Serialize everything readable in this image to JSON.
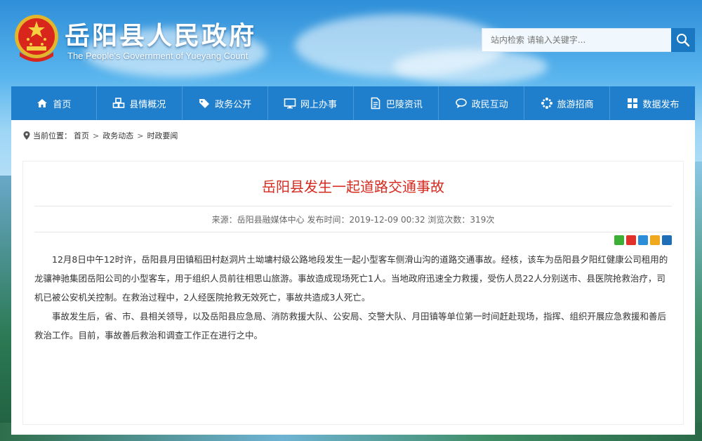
{
  "header": {
    "title": "岳阳县人民政府",
    "subtitle": "The People's Government of Yueyang Count",
    "search_placeholder": "站内检索 请输入关键字..."
  },
  "nav": {
    "items": [
      {
        "label": "首页",
        "icon": "home-icon"
      },
      {
        "label": "县情概况",
        "icon": "cubes-icon"
      },
      {
        "label": "政务公开",
        "icon": "tags-icon"
      },
      {
        "label": "网上办事",
        "icon": "monitor-icon"
      },
      {
        "label": "巴陵资讯",
        "icon": "document-icon"
      },
      {
        "label": "政民互动",
        "icon": "chat-icon"
      },
      {
        "label": "旅游招商",
        "icon": "pinwheel-icon"
      },
      {
        "label": "数据发布",
        "icon": "grid-icon"
      }
    ]
  },
  "breadcrumb": {
    "prefix": "当前位置：",
    "items": [
      "首页",
      "政务动态",
      "时政要闻"
    ],
    "separator": ">"
  },
  "article": {
    "title": "岳阳县发生一起道路交通事故",
    "meta": "来源：岳阳县融媒体中心 发布时间：2019-12-09 00:32 浏览次数：319次",
    "paragraphs": [
      "12月8日中午12时许，岳阳县月田镇稻田村赵洞片土坳墉村级公路地段发生一起小型客车侧滑山沟的道路交通事故。经核，该车为岳阳县夕阳红健康公司租用的龙骧神驰集团岳阳公司的小型客车，用于组织人员前往相思山旅游。事故造成现场死亡1人。当地政府迅速全力救援，受伤人员22人分别送市、县医院抢救治疗，司机已被公安机关控制。在救治过程中，2人经医院抢救无效死亡，事故共造成3人死亡。",
      "事故发生后，省、市、县相关领导，以及岳阳县应急局、消防救援大队、公安局、交警大队、月田镇等单位第一时间赶赴现场，指挥、组织开展应急救援和善后救治工作。目前，事故善后救治和调查工作正在进行之中。"
    ]
  },
  "colors": {
    "nav_bg": "#1f7fcd",
    "title_red": "#d52a1f",
    "search_btn": "#1a78c2"
  }
}
